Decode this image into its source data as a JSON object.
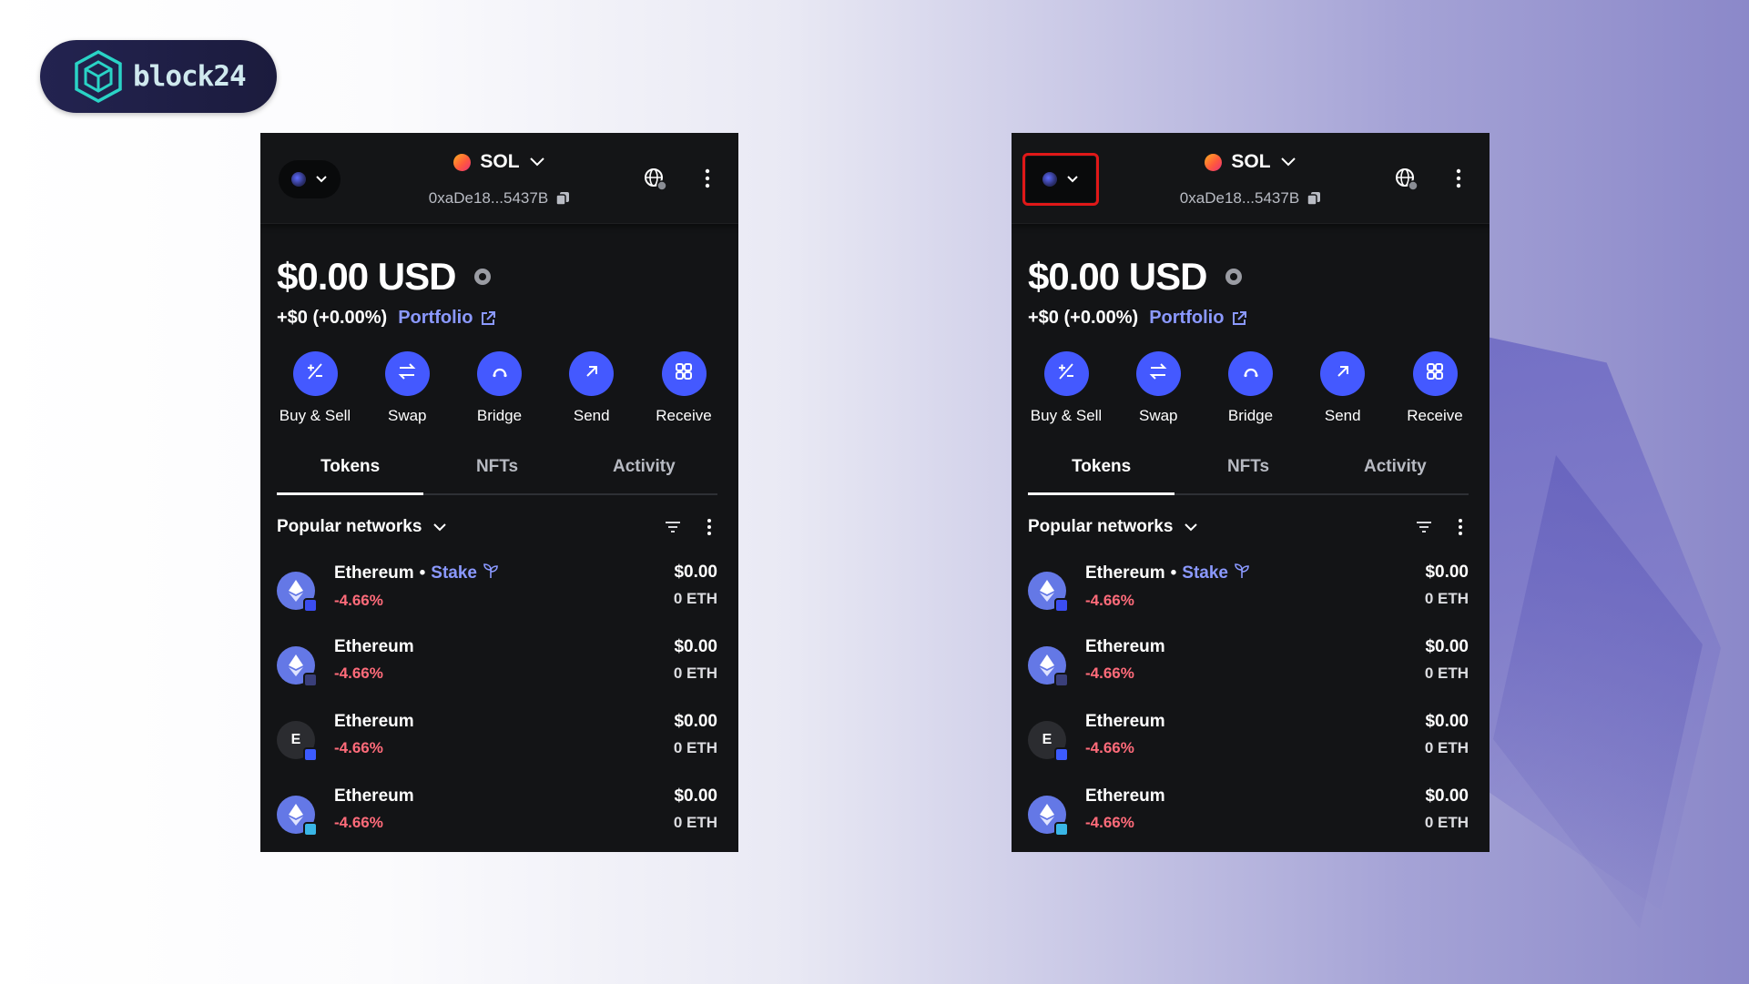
{
  "brand": {
    "name": "block24",
    "colors": {
      "pill_bg": "#1b1b3d",
      "mark": "#2ad3c6"
    }
  },
  "colors": {
    "accent": "#4459ff",
    "link": "#8b99ff",
    "negative": "#ff6b7a",
    "highlight": "#e01818"
  },
  "wallets": [
    {
      "id": "left",
      "header": {
        "network": "SOL",
        "address": "0xaDe18...5437B",
        "account_pill_highlighted": false
      },
      "balance": "$0.00 USD",
      "change": "+$0 (+0.00%)",
      "portfolio_label": "Portfolio",
      "actions": [
        {
          "label": "Buy & Sell",
          "icon": "plus-minus-icon"
        },
        {
          "label": "Swap",
          "icon": "swap-arrows-icon"
        },
        {
          "label": "Bridge",
          "icon": "bridge-arc-icon"
        },
        {
          "label": "Send",
          "icon": "arrow-up-right-icon"
        },
        {
          "label": "Receive",
          "icon": "qr-grid-icon"
        }
      ],
      "tabs": [
        "Tokens",
        "NFTs",
        "Activity"
      ],
      "active_tab": "Tokens",
      "filter_label": "Popular networks",
      "tokens": [
        {
          "name": "Ethereum",
          "separator": "•",
          "stake": "Stake",
          "change": "-4.66%",
          "value": "$0.00",
          "amount": "0 ETH",
          "icon": "eth",
          "badge": "#3b4df0"
        },
        {
          "name": "Ethereum",
          "change": "-4.66%",
          "value": "$0.00",
          "amount": "0 ETH",
          "icon": "eth",
          "badge": "#3a3f7a"
        },
        {
          "name": "Ethereum",
          "icon_letter": "E",
          "change": "-4.66%",
          "value": "$0.00",
          "amount": "0 ETH",
          "icon": "letter",
          "badge": "#3c5bff"
        },
        {
          "name": "Ethereum",
          "change": "-4.66%",
          "value": "$0.00",
          "amount": "0 ETH",
          "icon": "eth",
          "badge": "#39b6e6"
        }
      ]
    },
    {
      "id": "right",
      "header": {
        "network": "SOL",
        "address": "0xaDe18...5437B",
        "account_pill_highlighted": true
      },
      "balance": "$0.00 USD",
      "change": "+$0 (+0.00%)",
      "portfolio_label": "Portfolio",
      "actions": [
        {
          "label": "Buy & Sell",
          "icon": "plus-minus-icon"
        },
        {
          "label": "Swap",
          "icon": "swap-arrows-icon"
        },
        {
          "label": "Bridge",
          "icon": "bridge-arc-icon"
        },
        {
          "label": "Send",
          "icon": "arrow-up-right-icon"
        },
        {
          "label": "Receive",
          "icon": "qr-grid-icon"
        }
      ],
      "tabs": [
        "Tokens",
        "NFTs",
        "Activity"
      ],
      "active_tab": "Tokens",
      "filter_label": "Popular networks",
      "tokens": [
        {
          "name": "Ethereum",
          "separator": "•",
          "stake": "Stake",
          "change": "-4.66%",
          "value": "$0.00",
          "amount": "0 ETH",
          "icon": "eth",
          "badge": "#3b4df0"
        },
        {
          "name": "Ethereum",
          "change": "-4.66%",
          "value": "$0.00",
          "amount": "0 ETH",
          "icon": "eth",
          "badge": "#3a3f7a"
        },
        {
          "name": "Ethereum",
          "icon_letter": "E",
          "change": "-4.66%",
          "value": "$0.00",
          "amount": "0 ETH",
          "icon": "letter",
          "badge": "#3c5bff"
        },
        {
          "name": "Ethereum",
          "change": "-4.66%",
          "value": "$0.00",
          "amount": "0 ETH",
          "icon": "eth",
          "badge": "#39b6e6"
        }
      ]
    }
  ]
}
